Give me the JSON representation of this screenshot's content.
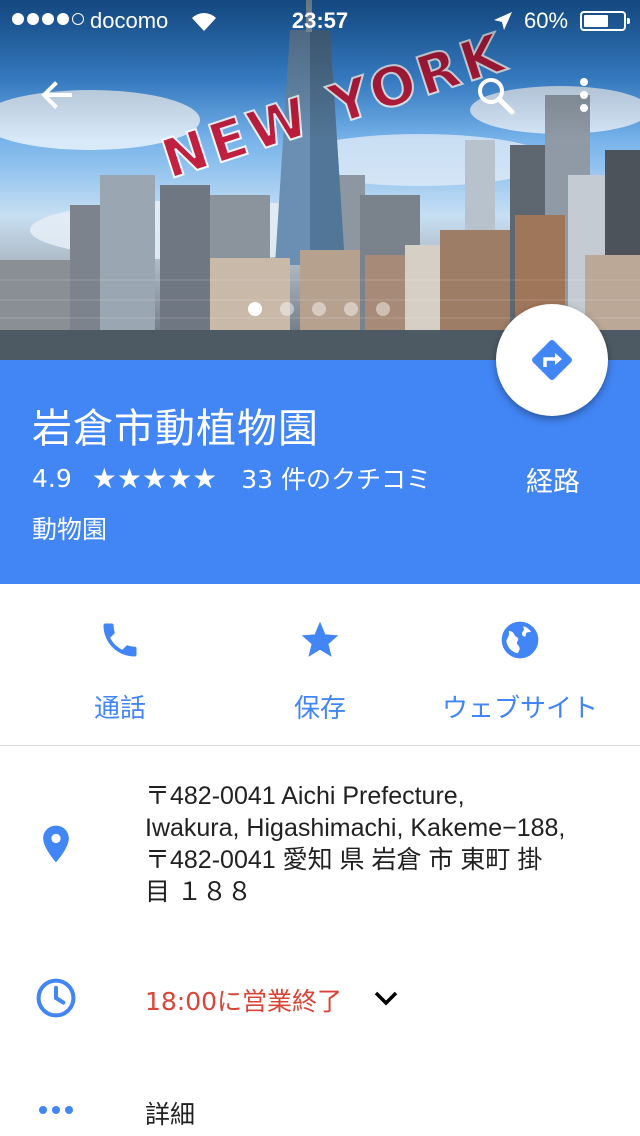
{
  "status_bar": {
    "carrier": "docomo",
    "time": "23:57",
    "battery": "60%"
  },
  "hero": {
    "sky_text": "NEW YORK",
    "pager_count": 5,
    "pager_active_index": 0
  },
  "place": {
    "name": "岩倉市動植物園",
    "rating": "4.9",
    "stars": "★★★★★",
    "reviews": "33 件のクチコミ",
    "route_label": "経路",
    "category": "動物園"
  },
  "actions": {
    "call": "通話",
    "save": "保存",
    "website": "ウェブサイト"
  },
  "details": {
    "address_lines": [
      "〒482-0041 Aichi Prefecture,",
      "Iwakura, Higashimachi, Kakeme−188,",
      "〒482-0041 愛知 県 岩倉 市 東町 掛",
      "目 １８８"
    ],
    "hours": "18:00に営業終了",
    "more": "詳細"
  },
  "colors": {
    "primary_blue": "#4285f4",
    "closing_red": "#db4437"
  },
  "icons": {
    "back": "arrow-left-icon",
    "search": "search-icon",
    "more": "more-vert-icon",
    "directions": "directions-icon",
    "call": "phone-icon",
    "save": "star-icon",
    "website": "globe-icon",
    "address": "location-pin-icon",
    "hours": "clock-icon",
    "details": "more-horiz-icon"
  }
}
